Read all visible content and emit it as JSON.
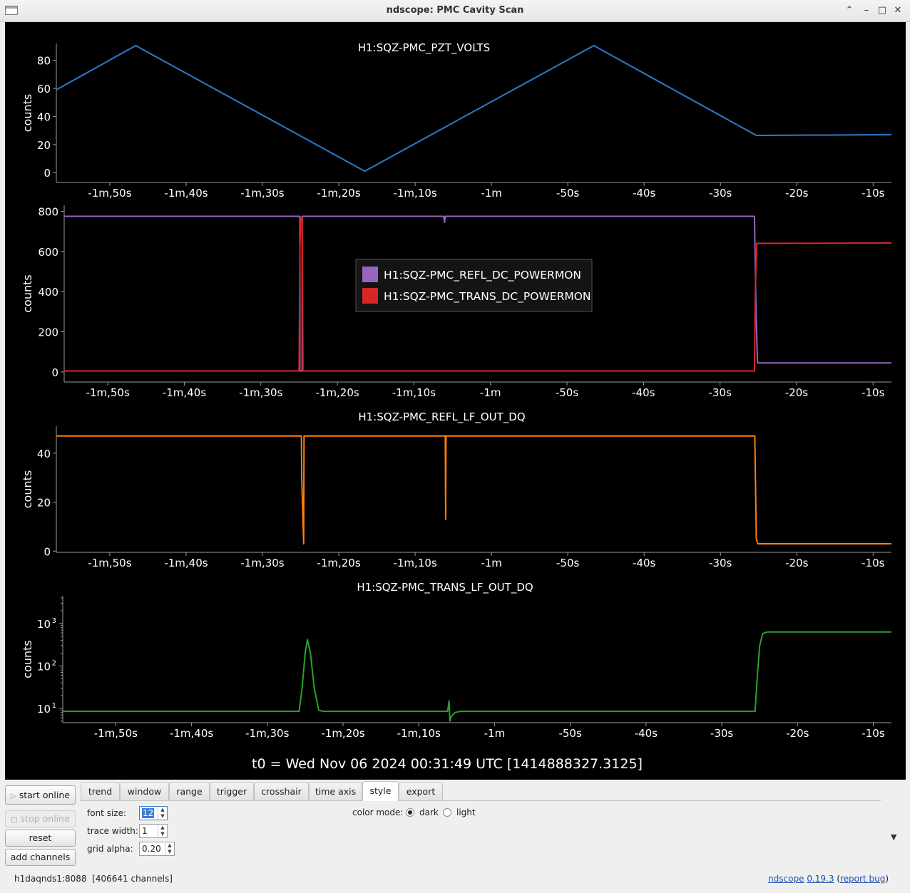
{
  "window": {
    "title": "ndscope: PMC Cavity Scan",
    "min_glyph": "⌃",
    "minimize_glyph": "–",
    "maximize_glyph": "□",
    "close_glyph": "✕"
  },
  "colors": {
    "pzt": "#2b7bca",
    "refl_dc": "#9467bd",
    "trans_dc": "#d62728",
    "refl_lf": "#ff7f0e",
    "trans_lf": "#2ca02c"
  },
  "x_tick_labels": [
    "-1m,50s",
    "-1m,40s",
    "-1m,30s",
    "-1m,20s",
    "-1m,10s",
    "-1m",
    "-50s",
    "-40s",
    "-30s",
    "-20s",
    "-10s"
  ],
  "x_tick_values": [
    -110,
    -100,
    -90,
    -80,
    -70,
    -60,
    -50,
    -40,
    -30,
    -20,
    -10
  ],
  "chart_data": [
    {
      "type": "line",
      "title": "H1:SQZ-PMC_PZT_VOLTS",
      "ylabel": "counts",
      "xlim": [
        -117,
        -7.6
      ],
      "ylim": [
        -7,
        92
      ],
      "yticks": [
        0,
        20,
        40,
        60,
        80
      ],
      "series": [
        {
          "color": "#2b7bca",
          "x": [
            -117,
            -106.6,
            -76.6,
            -46.6,
            -25.3,
            -7.6
          ],
          "y": [
            59,
            90.5,
            1,
            90.5,
            26.5,
            27
          ]
        }
      ]
    },
    {
      "type": "line",
      "title": "",
      "ylabel": "counts",
      "xlim": [
        -115.7,
        -7.6
      ],
      "ylim": [
        -50,
        830
      ],
      "yticks": [
        0,
        200,
        400,
        600,
        800
      ],
      "legend": [
        "H1:SQZ-PMC_REFL_DC_POWERMON",
        "H1:SQZ-PMC_TRANS_DC_POWERMON"
      ],
      "series": [
        {
          "name": "H1:SQZ-PMC_REFL_DC_POWERMON",
          "color": "#9467bd",
          "x": [
            -115.7,
            -84.9,
            -84.9,
            -84.6,
            -84.6,
            -66.1,
            -66.0,
            -65.9,
            -25.5,
            -25.3,
            -25.1,
            -7.6
          ],
          "y": [
            775,
            775,
            5,
            5,
            775,
            775,
            745,
            775,
            775,
            300,
            45,
            45
          ]
        },
        {
          "name": "H1:SQZ-PMC_TRANS_DC_POWERMON",
          "color": "#d62728",
          "x": [
            -115.7,
            -85.0,
            -84.9,
            -84.8,
            -84.6,
            -84.5,
            -25.5,
            -25.4,
            -25.2,
            -7.6
          ],
          "y": [
            5,
            5,
            600,
            770,
            770,
            5,
            5,
            400,
            640,
            642
          ]
        }
      ]
    },
    {
      "type": "line",
      "title": "H1:SQZ-PMC_REFL_LF_OUT_DQ",
      "ylabel": "counts",
      "xlim": [
        -117,
        -7.6
      ],
      "ylim": [
        -0.5,
        51
      ],
      "yticks": [
        0,
        20,
        40
      ],
      "series": [
        {
          "color": "#ff7f0e",
          "x": [
            -117,
            -84.9,
            -84.85,
            -84.6,
            -84.55,
            -66.05,
            -66.0,
            -65.95,
            -25.5,
            -25.3,
            -25.1,
            -7.6
          ],
          "y": [
            47,
            47,
            30,
            3,
            47,
            47,
            13,
            47,
            47,
            5,
            3,
            3
          ]
        }
      ]
    },
    {
      "type": "line",
      "title": "H1:SQZ-PMC_TRANS_LF_OUT_DQ",
      "ylabel": "counts",
      "y_scale": "log",
      "xlim": [
        -117,
        -7.6
      ],
      "ylim": [
        4.6,
        4500
      ],
      "yticks": [
        10,
        100,
        1000
      ],
      "ytick_labels": [
        "10",
        "10",
        "10"
      ],
      "ytick_exponents": [
        "1",
        "2",
        "3"
      ],
      "series": [
        {
          "color": "#2ca02c",
          "x": [
            -117,
            -85.8,
            -85.4,
            -85.0,
            -84.7,
            -84.3,
            -83.8,
            -83.2,
            -82.6,
            -66.2,
            -66.0,
            -65.9,
            -65.7,
            -65.2,
            -64.5,
            -25.6,
            -25.3,
            -25.0,
            -24.6,
            -24.0,
            -7.6
          ],
          "y": [
            8.5,
            8.5,
            30,
            200,
            420,
            200,
            30,
            9,
            8.5,
            8.5,
            15,
            5,
            6.5,
            8,
            8.5,
            8.5,
            60,
            300,
            580,
            630,
            630
          ]
        }
      ]
    }
  ],
  "t0_label": "t0 = Wed Nov 06 2024 00:31:49 UTC [1414888327.3125]",
  "buttons": {
    "start_online": "start online",
    "stop_online": "stop online",
    "reset": "reset",
    "add_channels": "add channels"
  },
  "tabs": [
    "trend",
    "window",
    "range",
    "trigger",
    "crosshair",
    "time axis",
    "style",
    "export"
  ],
  "active_tab": "style",
  "style_panel": {
    "font_size_label": "font size:",
    "font_size": "12",
    "trace_width_label": "trace width:",
    "trace_width": "1",
    "grid_alpha_label": "grid alpha:",
    "grid_alpha": "0.20",
    "color_mode_label": "color mode:",
    "dark_label": "dark",
    "light_label": "light",
    "color_mode": "dark"
  },
  "status": {
    "server": "h1daqnds1:8088",
    "channels": "[406641 channels]",
    "app": "ndscope",
    "version": "0.19.3",
    "report": "report bug",
    "paren_open": "(",
    "paren_close": ")"
  }
}
